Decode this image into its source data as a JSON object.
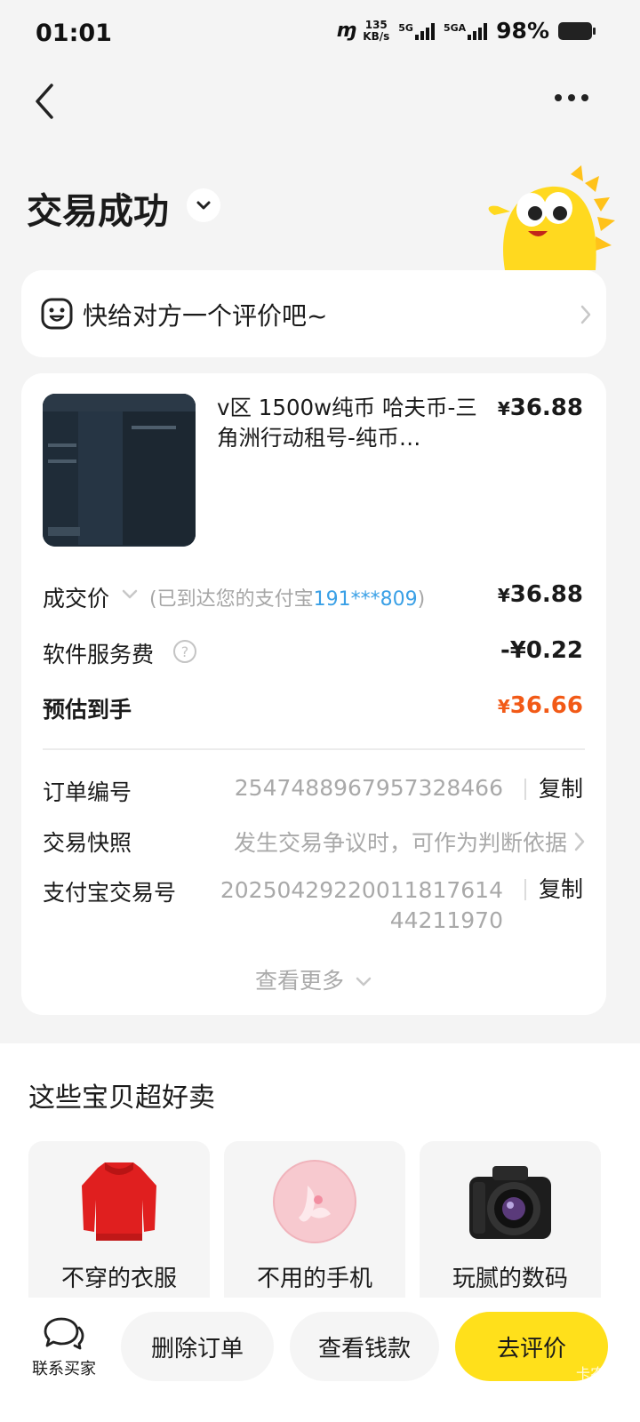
{
  "status": {
    "time": "01:01",
    "speed_value": "135",
    "speed_unit": "KB/s",
    "net1": "5G",
    "net2": "5GA",
    "battery": "98%"
  },
  "header": {
    "title": "交易成功"
  },
  "review": {
    "text": "快给对方一个评价吧~"
  },
  "product": {
    "title": "v区 1500w纯币 哈夫币-三角洲行动租号-纯币…",
    "currency": "¥",
    "price": "36.88"
  },
  "summary": {
    "deal_label": "成交价",
    "deal_note_prefix": "(已到达您的支付宝",
    "deal_note_account": "191***809",
    "deal_note_suffix": ")",
    "deal_value": "36.88",
    "fee_label": "软件服务费",
    "fee_value": "-¥0.22",
    "estimate_label": "预估到手",
    "estimate_value": "36.66"
  },
  "info": {
    "order_label": "订单编号",
    "order_value": "2547488967957328466",
    "copy_label": "复制",
    "snapshot_label": "交易快照",
    "snapshot_value": "发生交易争议时，可作为判断依据",
    "alipay_label": "支付宝交易号",
    "alipay_value_line1": "20250429220011817614",
    "alipay_value_line2": "44211970",
    "see_more": "查看更多"
  },
  "recommend": {
    "title": "这些宝贝超好卖",
    "items": [
      {
        "label": "不穿的衣服",
        "icon": "sweater-icon"
      },
      {
        "label": "不用的手机",
        "icon": "phone-icon"
      },
      {
        "label": "玩腻的数码",
        "icon": "camera-icon"
      }
    ]
  },
  "bottom": {
    "contact_label": "联系买家",
    "delete_label": "删除订单",
    "view_money_label": "查看钱款",
    "review_label": "去评价",
    "watermark": "卡农社区"
  },
  "colors": {
    "accent": "#ffe01b",
    "price_orange": "#f25a17",
    "link_blue": "#3aa0e6"
  }
}
